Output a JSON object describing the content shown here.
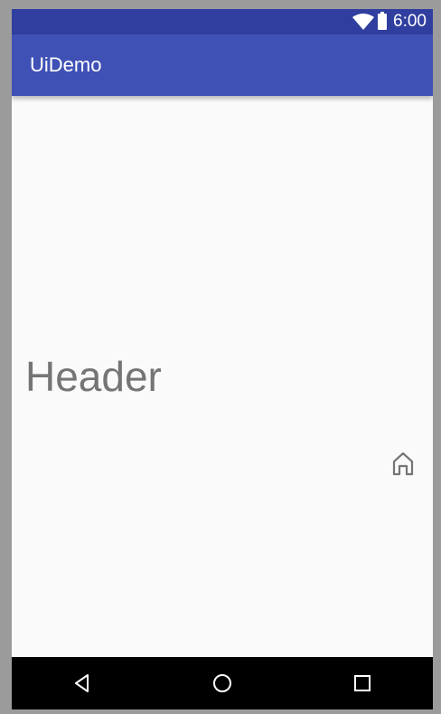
{
  "status_bar": {
    "time": "6:00",
    "icons": [
      "wifi-icon",
      "battery-icon"
    ]
  },
  "app_bar": {
    "title": "UiDemo"
  },
  "content": {
    "header": "Header",
    "icon": "home-icon"
  },
  "nav_bar": {
    "buttons": [
      "back-icon",
      "home-circle-icon",
      "recents-icon"
    ]
  },
  "colors": {
    "status_bar": "#303f9f",
    "app_bar": "#3f51b5",
    "background": "#fafafa",
    "header_text": "#757575",
    "nav_bar": "#000000"
  }
}
